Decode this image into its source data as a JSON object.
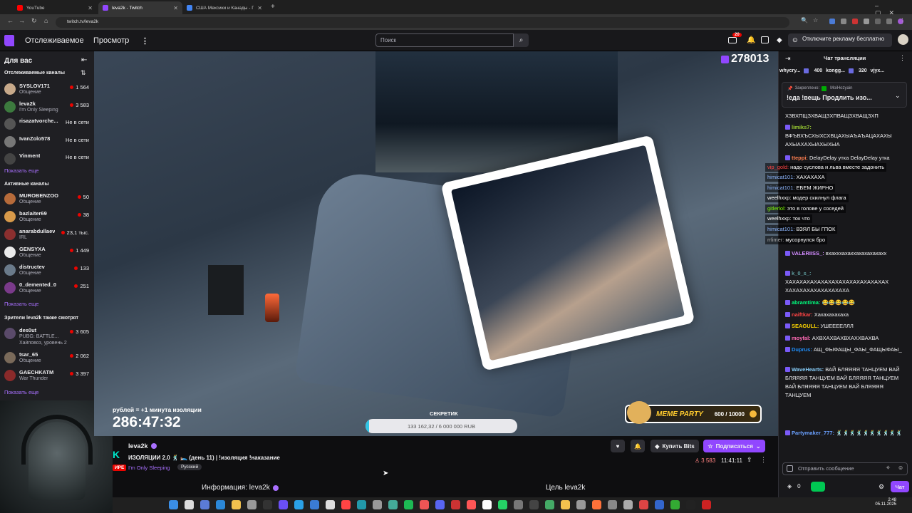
{
  "browser": {
    "tabs": [
      {
        "label": "YouTube",
        "color": "#ff0000"
      },
      {
        "label": "leva2k - Twitch",
        "color": "#9147ff"
      },
      {
        "label": "США Мексики и Канады - Пои",
        "color": "#4285f4"
      }
    ],
    "url": "twitch.tv/leva2k",
    "clock": "2:48",
    "date": "05.11.2025"
  },
  "nav": {
    "following": "Отслеживаемое",
    "browse": "Просмотр",
    "search_placeholder": "Поиск",
    "notif_count": "20",
    "adfree": "Отключите рекламу бесплатно"
  },
  "sidebar": {
    "for_you": "Для вас",
    "followed_title": "Отслеживаемые каналы",
    "followed": [
      {
        "name": "SYSLOV171",
        "game": "Общение",
        "viewers": "1 564",
        "color": "#c7a98a"
      },
      {
        "name": "leva2k",
        "game": "I'm Only Sleeping",
        "viewers": "3 583",
        "color": "#3c7a3e"
      },
      {
        "name": "risazatvorche...",
        "game": "",
        "viewers": "Не в сети",
        "color": "#555"
      },
      {
        "name": "IvanZolo578",
        "game": "",
        "viewers": "Не в сети",
        "color": "#777"
      },
      {
        "name": "Vinment",
        "game": "",
        "viewers": "Не в сети",
        "color": "#444"
      }
    ],
    "show_more": "Показать еще",
    "active_title": "Активные каналы",
    "active": [
      {
        "name": "MUROBENZOO",
        "game": "Общение",
        "viewers": "50",
        "color": "#b76b3a"
      },
      {
        "name": "bazlaiter69",
        "game": "Общение",
        "viewers": "38",
        "color": "#d89a4a"
      },
      {
        "name": "anarabdullaev",
        "game": "IRL",
        "viewers": "23,1 тыс.",
        "color": "#8b2f2f"
      },
      {
        "name": "GENSYXA",
        "game": "Общение",
        "viewers": "1 449",
        "color": "#eaeaea"
      },
      {
        "name": "distructev",
        "game": "Общение",
        "viewers": "133",
        "color": "#6a7a8a"
      },
      {
        "name": "0_demented_0",
        "game": "Общение",
        "viewers": "251",
        "color": "#7a3a8a"
      }
    ],
    "similar_title": "Зрители leva2k также смотрят",
    "similar": [
      {
        "name": "des0ut",
        "game": "PUBG: BATTLE...",
        "extra": "Хайповоз, уровень 2",
        "viewers": "3 605",
        "color": "#5a4a6a"
      },
      {
        "name": "tsar_65",
        "game": "Общение",
        "viewers": "2 062",
        "color": "#7a6a5a"
      },
      {
        "name": "GAECHKATM",
        "game": "War Thunder",
        "viewers": "3 397",
        "color": "#8a2a2a"
      }
    ]
  },
  "video": {
    "viewers": "278013",
    "iso_text": "рублей = +1 минута изоляции",
    "timer": "286:47:32",
    "goal_label": "СЕКРЕТИК",
    "goal_progress": 0.022,
    "goal_text": "133 162,32 / 6 000 000 RUB",
    "meme_name": "MEME PARTY",
    "meme_count": "600 / 10000"
  },
  "stream": {
    "channel": "leva2k",
    "title": "ИЗОЛЯЦИИ 2.0 🕺 🛌 (день 11) | !изоляция !наказание",
    "live": "ИРЕ",
    "category": "I'm Only Sleeping",
    "tag": "Русский",
    "bits": "Купить Bits",
    "subscribe": "Подписаться",
    "viewers": "3 583",
    "uptime": "11:41:11",
    "about": "Информация: leva2k",
    "goal": "Цель leva2k"
  },
  "chat": {
    "title": "Чат трансляции",
    "top": [
      {
        "name": "whycry...",
        "n": ""
      },
      {
        "name": "",
        "n": "400"
      },
      {
        "name": "kongg...",
        "n": ""
      },
      {
        "name": "",
        "n": "320"
      },
      {
        "name": "vjyx...",
        "n": ""
      }
    ],
    "pinned_label": "Закреплено:",
    "pinned_by": "MoiHozyain",
    "pinned_text": "!еда !вещь Продлить изо...",
    "messages": [
      {
        "user": "",
        "color": "#efeff1",
        "text": "ХЗВХПЩЗХВАЩЗХПВАЩЗХВАЩЗХП"
      },
      {
        "user": "limiks7:",
        "color": "#9acd32",
        "text": "ВФЪВХЪСХЫХСХВЦАХЫАЪАЪАЦАХАХЫ АХЫАХАХЫАХЫХЫА"
      },
      {
        "user": "tteppi:",
        "color": "#ff7f50",
        "text": "DelayDelay утка DelayDelay утка"
      },
      {
        "user": "VALERIISS_:",
        "color": "#d28bff",
        "text": "вхахххахаххахахахахахх"
      },
      {
        "user": "k_0_s_:",
        "color": "#5f9ea0",
        "text": "ХАХАХАХАХАХАХАХАХАХАХАХАХАХАХ ХАХАХАХАХАХАХАХАХА"
      },
      {
        "user": "abramtima:",
        "color": "#00ff7f",
        "text": "😂😂😂😂😂"
      },
      {
        "user": "naiftkar:",
        "color": "#ff4444",
        "text": "Хахахахахаха"
      },
      {
        "user": "SEAGULL:",
        "color": "#ffd700",
        "text": "УШЕЕЕЕЛЛЛ"
      },
      {
        "user": "moyfal:",
        "color": "#ff69b4",
        "text": "АХВХАХВАХВХАХХВАХВА"
      },
      {
        "user": "Duprus:",
        "color": "#1e90ff",
        "text": "АЩ_ФЫФАЩЫ_ФАЫ_ФАЩЫФАЫ_"
      },
      {
        "user": "WaveHearts:",
        "color": "#87cefa",
        "text": "ВАЙ БЛЯЯЯЯ ТАНЦУЕМ ВАЙ БЛЯЯЯЯ ТАНЦУЕМ ВАЙ БЛЯЯЯЯ ТАНЦУЕМ ВАЙ БЛЯЯЯЯ ТАНЦУЕМ ВАЙ БЛЯЯЯЯ ТАНЦУЕМ"
      },
      {
        "user": "Partymaker_777:",
        "color": "#6aa0ff",
        "text": "🕺🕺🕺🕺🕺🕺🕺🕺🕺🕺"
      }
    ],
    "overlay": [
      {
        "user": "vip_gold:",
        "color": "#ff4444",
        "text": "надо суслова и льва вместе задонить"
      },
      {
        "user": "himicat101:",
        "color": "#8fb7ff",
        "text": "ХАХАХАХА"
      },
      {
        "user": "himicat101:",
        "color": "#8fb7ff",
        "text": "ЕБЕМ ЖИРНО"
      },
      {
        "user": "weelhxxp:",
        "color": "#ffffff",
        "text": "модер скилнул флага"
      },
      {
        "user": "gitlerlol:",
        "color": "#7fff00",
        "text": "это в голове у соседей"
      },
      {
        "user": "weelhxxp:",
        "color": "#ffffff",
        "text": "ток что"
      },
      {
        "user": "himicat101:",
        "color": "#8fb7ff",
        "text": "ВЗЯЛ БЫ ГПОК"
      },
      {
        "user": "rrlimer:",
        "color": "#aaaaaa",
        "text": "мусорнулся бро"
      }
    ],
    "input_placeholder": "Отправить сообщение",
    "points": "0",
    "send": "Чат"
  }
}
